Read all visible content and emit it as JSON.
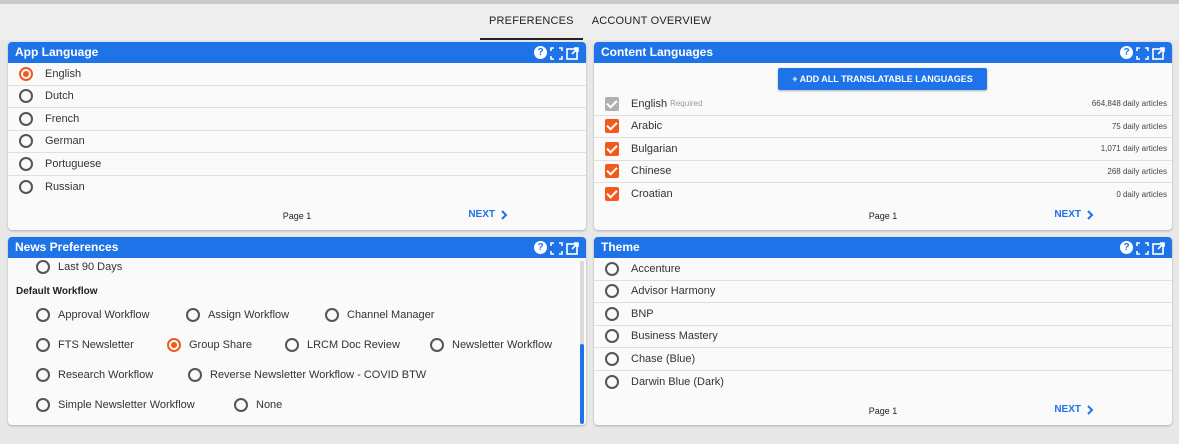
{
  "tabs": [
    "PREFERENCES",
    "ACCOUNT OVERVIEW"
  ],
  "app_language": {
    "title": "App Language",
    "options": [
      "English",
      "Dutch",
      "French",
      "German",
      "Portuguese",
      "Russian"
    ],
    "selected": "English",
    "page": "Page 1",
    "next": "NEXT"
  },
  "content_languages": {
    "title": "Content Languages",
    "add_button": "+ ADD ALL TRANSLATABLE LANGUAGES",
    "required_label": "Required",
    "items": [
      {
        "name": "English",
        "count": "664,848 daily articles"
      },
      {
        "name": "Arabic",
        "count": "75 daily articles"
      },
      {
        "name": "Bulgarian",
        "count": "1,071 daily articles"
      },
      {
        "name": "Chinese",
        "count": "268 daily articles"
      },
      {
        "name": "Croatian",
        "count": "0 daily articles"
      }
    ],
    "page": "Page 1",
    "next": "NEXT"
  },
  "news_preferences": {
    "title": "News Preferences",
    "date_option": "Last 90 Days",
    "workflow_heading": "Default Workflow",
    "workflows": [
      "Approval Workflow",
      "Assign Workflow",
      "Channel Manager",
      "FTS Newsletter",
      "Group Share",
      "LRCM Doc Review",
      "Newsletter Workflow",
      "Research Workflow",
      "Reverse Newsletter Workflow - COVID BTW",
      "Simple Newsletter Workflow",
      "None"
    ],
    "selected": "Group Share"
  },
  "theme": {
    "title": "Theme",
    "options": [
      "Accenture",
      "Advisor Harmony",
      "BNP",
      "Business Mastery",
      "Chase (Blue)",
      "Darwin Blue (Dark)"
    ],
    "page": "Page 1",
    "next": "NEXT"
  },
  "colors": {
    "accent": "#1e73e8",
    "selected": "#f25a1d"
  }
}
